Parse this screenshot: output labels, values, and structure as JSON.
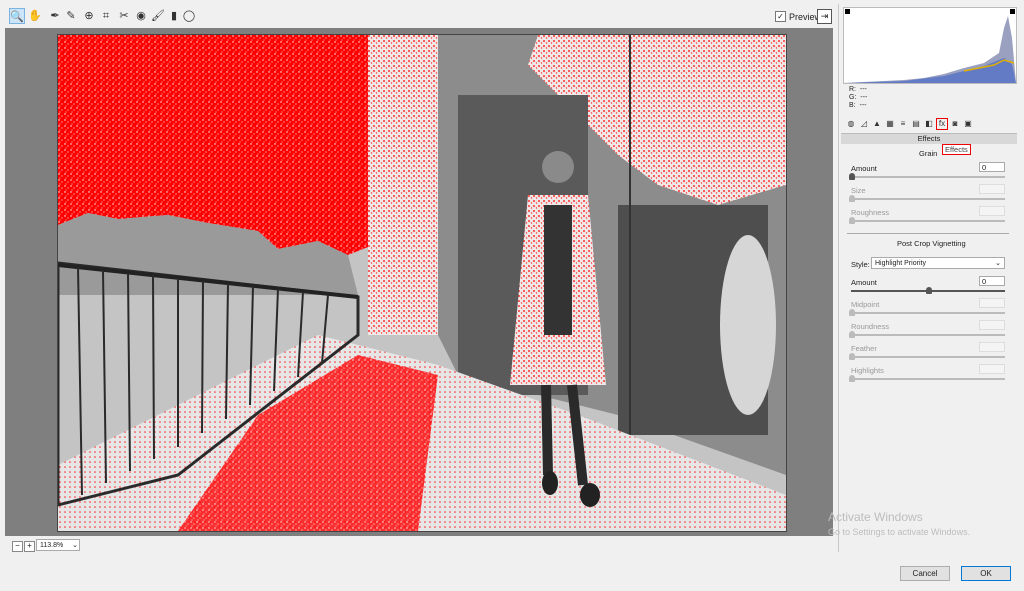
{
  "toolbar": {
    "tools": [
      "zoom-icon",
      "hand-icon",
      "white-balance-icon",
      "color-sampler-icon",
      "target-adjust-icon",
      "crop-icon",
      "spot-removal-icon",
      "red-eye-icon",
      "brush-icon",
      "gradient-icon",
      "radial-filter-icon"
    ],
    "preview_label": "Preview",
    "preview_checked": "✓"
  },
  "status": {
    "zoom_value": "113.8%"
  },
  "panel": {
    "rgb": {
      "r_label": "R:",
      "r_value": "---",
      "g_label": "G:",
      "g_value": "---",
      "b_label": "B:",
      "b_value": "---"
    },
    "effects_header": "Effects",
    "grain_tab": "Grain",
    "effects_tab": "Effects",
    "grain": {
      "amount_label": "Amount",
      "amount_value": "0",
      "size_label": "Size",
      "roughness_label": "Roughness"
    },
    "vignetting": {
      "title": "Post Crop Vignetting",
      "style_label": "Style:",
      "style_value": "Highlight Priority",
      "amount_label": "Amount",
      "amount_value": "0",
      "midpoint_label": "Midpoint",
      "roundness_label": "Roundness",
      "feather_label": "Feather",
      "highlights_label": "Highlights"
    }
  },
  "watermark": {
    "line1": "Activate Windows",
    "line2": "Go to Settings to activate Windows."
  },
  "buttons": {
    "cancel": "Cancel",
    "ok": "OK"
  },
  "colors": {
    "clip_red": "#ff0000",
    "accent": "#0078d7"
  }
}
